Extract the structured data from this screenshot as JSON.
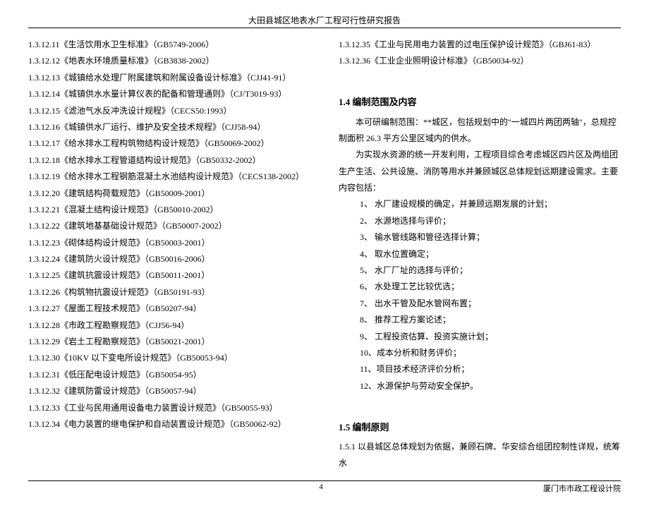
{
  "header": {
    "title": "大田县城区地表水厂工程可行性研究报告"
  },
  "left": {
    "items": [
      "1.3.12.11《生活饮用水卫生标准》（GB5749-2006）",
      "1.3.12.12《地表水环境质量标准》（GB3838-2002）",
      "1.3.12.13《城镇给水处理厂附属建筑和附属设备设计标准》（CJJ41-91）",
      "1.3.12.14《城镇供水水量计算仪表的配备和管理通则》（CJ/T3019-93）",
      "1.3.12.15《滤池气水反冲洗设计规程》（CECS50:1993）",
      "1.3.12.16《城镇供水厂运行、维护及安全技术规程》（CJJ58-94）",
      "1.3.12.17《给水排水工程构筑物结构设计规范》（GB50069-2002）",
      "1.3.12.18《给水排水工程管道结构设计规范》（GB50332-2002）",
      "1.3.12.19《给水排水工程钢筋混凝土水池结构设计规范》（CECS138-2002）",
      "1.3.12.20《建筑结构荷载规范》（GB50009-2001）",
      "1.3.12.21《混凝土结构设计规范》（GB50010-2002）",
      "1.3.12.22《建筑地基基础设计规范》（GB50007-2002）",
      "1.3.12.23《砌体结构设计规范》（GB50003-2001）",
      "1.3.12.24《建筑防火设计规范》（GB50016-2006）",
      "1.3.12.25《建筑抗震设计规范》（GB50011-2001）",
      "1.3.12.26《构筑物抗震设计规范》（GB50191-93）",
      "1.3.12.27《屋面工程技术规范》（GB50207-94）",
      "1.3.12.28《市政工程勘察规范》（CJJ56-94）",
      "1.3.12.29《岩土工程勘察规范》（GB50021-2001）",
      "1.3.12.30《10KV 以下变电所设计规范》（GB50053-94）",
      "1.3.12.31《低压配电设计规范》（GB50054-95）",
      "1.3.12.32《建筑防雷设计规范》（GB50057-94）",
      "1.3.12.33《工业与民用通用设备电力装置设计规范》（GB50055-93）",
      "1.3.12.34《电力装置的继电保护和自动装置设计规范》（GB50062-92）"
    ]
  },
  "right": {
    "items_top": [
      "1.3.12.35《工业与民用电力装置的过电压保护设计规范》（GBJ61-83）",
      "1.3.12.36《工业企业照明设计标准》（GB50034-92）"
    ],
    "section14_title": "1.4 编制范围及内容",
    "para1": "本可研编制范围：**城区，包括规划中的\"一城四片两团两轴\"，总规控制面积 26.3 平方公里区域内的供水。",
    "para2": "为实现水资源的统一开发利用，工程项目综合考虑城区四片区及两组团生产生活、公共设施、消防等用水并兼顾城区总体规划远期建设需求。主要内容包括：",
    "list14": [
      "1、 水厂建设规模的确定，并兼顾远期发展的计划；",
      "2、 水源地选择与评价；",
      "3、 输水管线路和管径选择计算；",
      "4、 取水位置确定；",
      "5、 水厂厂址的选择与评价；",
      "6、 水处理工艺比较优选；",
      "7、 出水干管及配水管网布置；",
      "8、 推荐工程方案论述；",
      "9、 工程投资估算、投资实施计划；",
      "10、成本分析和财务评价；",
      "11、项目技术经济评价分析；",
      "12、水源保护与劳动安全保护。"
    ],
    "section15_title": "1.5 编制原则",
    "para151": "1.5.1 以县城区总体规划为依据，兼顾石牌、华安综合组团控制性详规，统筹水"
  },
  "footer": {
    "page": "4",
    "org": "厦门市市政工程设计院"
  }
}
